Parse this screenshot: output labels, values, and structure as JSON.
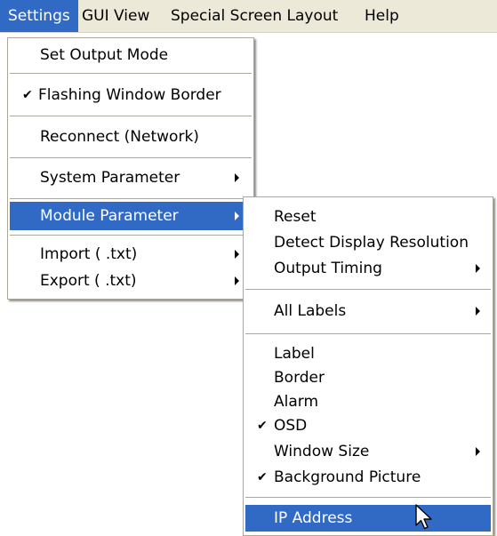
{
  "menubar": {
    "items": [
      {
        "label": "Settings",
        "active": true
      },
      {
        "label": "GUI View"
      },
      {
        "label": "Special Screen Layout"
      },
      {
        "label": "Help"
      }
    ]
  },
  "settings_menu": {
    "items": [
      {
        "label": "Set Output Mode"
      },
      {
        "label": "Flashing Window Border",
        "checked": true
      },
      {
        "label": "Reconnect (Network)"
      },
      {
        "label": "System Parameter",
        "submenu": true
      },
      {
        "label": "Module Parameter",
        "submenu": true,
        "highlighted": true
      },
      {
        "label": "Import ( .txt)",
        "submenu": true
      },
      {
        "label": "Export ( .txt)",
        "submenu": true
      }
    ],
    "check_mark": "✔"
  },
  "module_menu": {
    "items": [
      {
        "label": "Reset"
      },
      {
        "label": "Detect Display Resolution"
      },
      {
        "label": "Output Timing",
        "submenu": true
      },
      {
        "label": "All Labels",
        "submenu": true
      },
      {
        "label": "Label"
      },
      {
        "label": "Border"
      },
      {
        "label": "Alarm"
      },
      {
        "label": "OSD",
        "checked": true
      },
      {
        "label": "Window Size",
        "submenu": true
      },
      {
        "label": "Background Picture",
        "checked": true
      },
      {
        "label": "IP Address",
        "highlighted": true
      }
    ]
  },
  "colors": {
    "highlight": "#316ac5",
    "menubar_bg": "#ece9d8",
    "menu_border": "#aca899"
  },
  "icons": {
    "cursor": "arrow-cursor-icon"
  }
}
